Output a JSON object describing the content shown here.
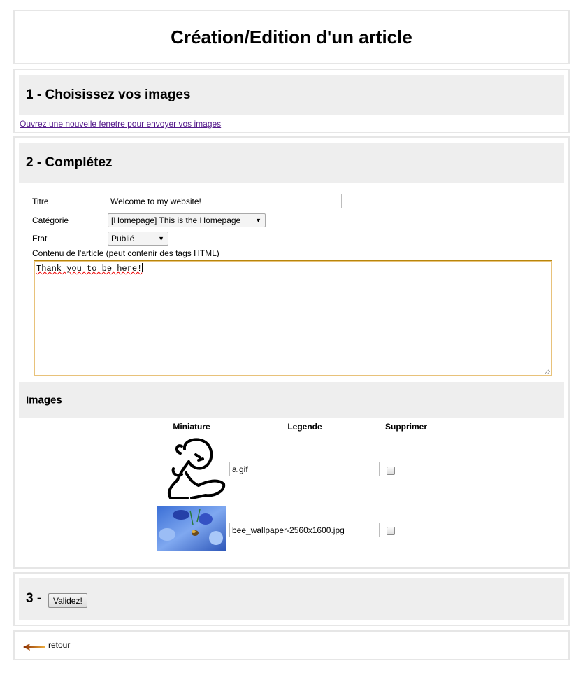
{
  "page": {
    "title": "Création/Edition d'un article"
  },
  "section1": {
    "heading": "1 - Choisissez vos images",
    "link_text": "Ouvrez une nouvelle fenetre pour envoyer vos images"
  },
  "section2": {
    "heading": "2 - Complétez",
    "fields": {
      "title_label": "Titre",
      "title_value": "Welcome to my website!",
      "category_label": "Catégorie",
      "category_value": "[Homepage] This is the Homepage",
      "state_label": "Etat",
      "state_value": "Publié",
      "content_label": "Contenu de l'article (peut contenir des tags HTML)",
      "content_value": "Thank you to be here!"
    },
    "images": {
      "heading": "Images",
      "columns": [
        "Miniature",
        "Legende",
        "Supprimer"
      ],
      "rows": [
        {
          "caption": "a.gif",
          "delete_checked": false,
          "thumb_icon": "sitting-figure-icon"
        },
        {
          "caption": "bee_wallpaper-2560x1600.jpg",
          "delete_checked": false,
          "thumb_icon": "bee-flower-photo"
        }
      ]
    }
  },
  "section3": {
    "number": "3 -",
    "submit_label": "Validez!"
  },
  "footer": {
    "back_label": "retour",
    "back_icon": "back-arrow-icon"
  },
  "colors": {
    "band_bg": "#eeeeee",
    "border": "#e6e6e6",
    "link_visited": "#551a8b",
    "textarea_focus": "#b8860b"
  }
}
